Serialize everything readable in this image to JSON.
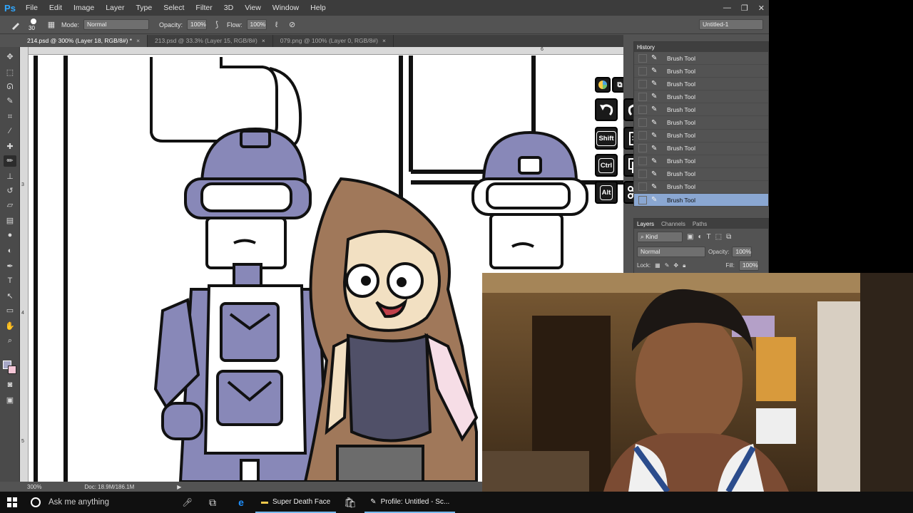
{
  "app": {
    "logo": "Ps",
    "workspace": "Untitled-1"
  },
  "menu": [
    "File",
    "Edit",
    "Image",
    "Layer",
    "Type",
    "Select",
    "Filter",
    "3D",
    "View",
    "Window",
    "Help"
  ],
  "window_controls": {
    "minimize": "—",
    "restore": "❐",
    "close": "✕"
  },
  "options": {
    "brush_size": "30",
    "mode_label": "Mode:",
    "mode_value": "Normal",
    "opacity_label": "Opacity:",
    "opacity_value": "100%",
    "flow_label": "Flow:",
    "flow_value": "100%"
  },
  "tabs": [
    {
      "label": "214.psd @ 300% (Layer 18, RGB/8#) *",
      "close": "×"
    },
    {
      "label": "213.psd @ 33.3% (Layer 15, RGB/8#)",
      "close": "×"
    },
    {
      "label": "079.png @ 100% (Layer 0, RGB/8#)",
      "close": "×"
    }
  ],
  "status": {
    "zoom": "300%",
    "doc": "Doc: 18.9M/186.1M",
    "arrow": "▶"
  },
  "ruler": {
    "h_mark": "6",
    "v_marks": [
      "3",
      "4",
      "5"
    ]
  },
  "history": {
    "title": "History",
    "items": [
      "Brush Tool",
      "Brush Tool",
      "Brush Tool",
      "Brush Tool",
      "Brush Tool",
      "Brush Tool",
      "Brush Tool",
      "Brush Tool",
      "Brush Tool",
      "Brush Tool",
      "Brush Tool",
      "Brush Tool"
    ],
    "selected_index": 11
  },
  "layers": {
    "tabs": [
      "Layers",
      "Channels",
      "Paths"
    ],
    "kind": "Kind",
    "blend": "Normal",
    "opacity_label": "Opacity:",
    "opacity_value": "100%",
    "lock_label": "Lock:",
    "fill_label": "Fill:",
    "fill_value": "100%"
  },
  "shortcut_pad": {
    "shift": "Shift",
    "ctrl": "Ctrl",
    "alt": "Alt"
  },
  "taskbar": {
    "search_placeholder": "Ask me anything",
    "apps": [
      {
        "label": "Super Death Face",
        "icon": "folder-icon"
      },
      {
        "label": "Profile: Untitled - Sc...",
        "icon": "app-icon"
      }
    ]
  },
  "colors": {
    "accent": "#31a8ff",
    "history_selected": "#8aa7d2",
    "helmet": "#8888b8",
    "hair": "#a0785a",
    "skin": "#f2e0c2"
  }
}
